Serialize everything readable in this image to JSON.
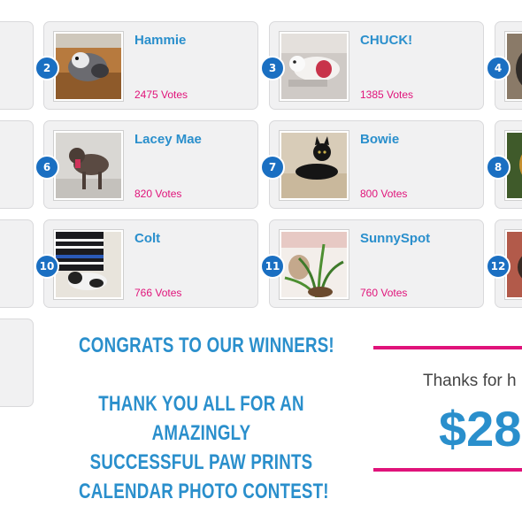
{
  "entries": [
    {
      "rank": "2",
      "name": "Hammie",
      "votes": "2475 Votes",
      "photo": "dog-photo"
    },
    {
      "rank": "3",
      "name": "CHUCK!",
      "votes": "1385 Votes",
      "photo": "dog-photo"
    },
    {
      "rank": "4",
      "name": "",
      "votes": "",
      "photo": "dog-photo"
    },
    {
      "rank": "6",
      "name": "Lacey Mae",
      "votes": "820 Votes",
      "photo": "dog-photo"
    },
    {
      "rank": "7",
      "name": "Bowie",
      "votes": "800 Votes",
      "photo": "cat-photo"
    },
    {
      "rank": "8",
      "name": "",
      "votes": "",
      "photo": "dog-photo"
    },
    {
      "rank": "10",
      "name": "Colt",
      "votes": "766 Votes",
      "photo": "cat-photo"
    },
    {
      "rank": "11",
      "name": "SunnySpot",
      "votes": "760 Votes",
      "photo": "cat-photo"
    },
    {
      "rank": "12",
      "name": "",
      "votes": "",
      "photo": "dog-photo"
    }
  ],
  "congrats": {
    "line1": "CONGRATS TO OUR WINNERS!",
    "line2": "THANK YOU ALL FOR AN",
    "line3": "AMAZINGLY",
    "line4": "SUCCESSFUL PAW PRINTS",
    "line5": "CALENDAR PHOTO CONTEST!"
  },
  "thanks": {
    "text": "Thanks for h",
    "amount": "$28"
  },
  "colors": {
    "name": "#2a8fcc",
    "votes": "#e0137a",
    "rank_badge": "#1a6fc2",
    "card_bg": "#f1f1f2",
    "pink_rule": "#e0137a"
  }
}
